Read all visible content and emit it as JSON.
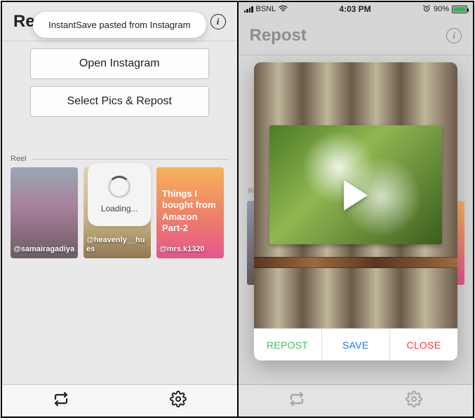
{
  "left": {
    "title": "Repost",
    "toast": "InstantSave pasted from Instagram",
    "buttons": {
      "open": "Open Instagram",
      "select": "Select Pics & Repost"
    },
    "section": "Reel",
    "loading": "Loading...",
    "thumbs": [
      {
        "user": "@samairagadiya"
      },
      {
        "user": "@heavenly__hues"
      },
      {
        "user": "@mrs.k1320",
        "overlay_text": "Things I bought from Amazon Part-2"
      }
    ]
  },
  "right": {
    "status": {
      "carrier": "BSNL",
      "time": "4:03 PM",
      "battery": "90%"
    },
    "title": "Repost",
    "section": "Reel",
    "actions": {
      "repost": "REPOST",
      "save": "SAVE",
      "close": "CLOSE"
    },
    "colors": {
      "repost": "#34c759",
      "save": "#0a7aff",
      "close": "#ff3b30"
    }
  }
}
